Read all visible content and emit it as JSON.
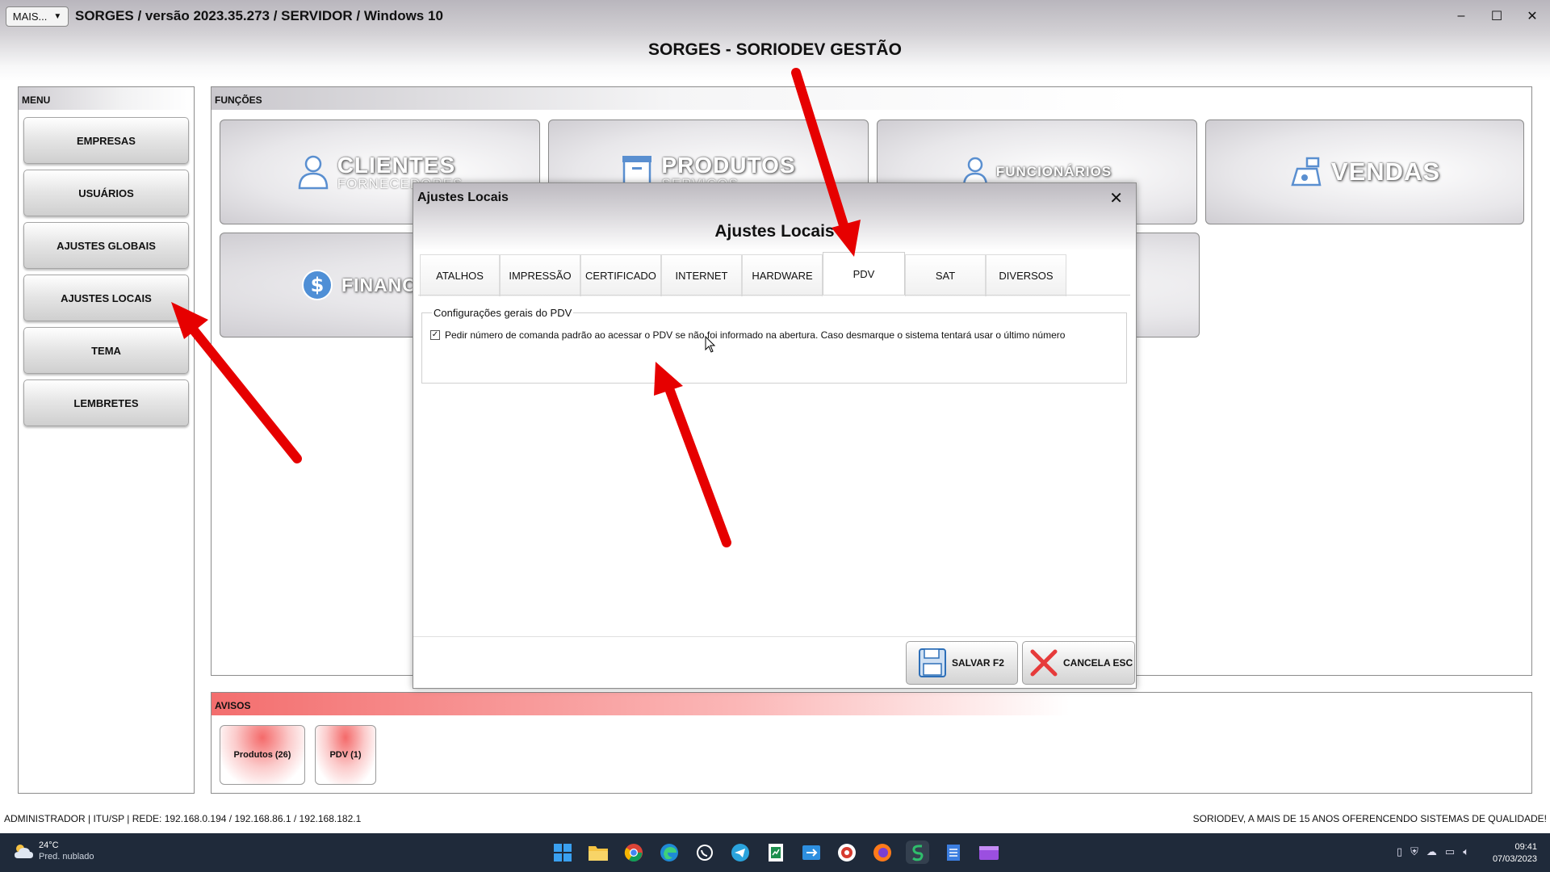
{
  "titlebar": {
    "mais_label": "MAIS...",
    "mais_arrow": "▼",
    "title": "SORGES / versão 2023.35.273 / SERVIDOR / Windows 10",
    "minimize": "–",
    "maximize": "☐",
    "close": "✕"
  },
  "header": {
    "title": "SORGES - SORIODEV GESTÃO"
  },
  "menu": {
    "heading": "MENU",
    "items": [
      {
        "label": "EMPRESAS"
      },
      {
        "label": "USUÁRIOS"
      },
      {
        "label": "AJUSTES GLOBAIS"
      },
      {
        "label": "AJUSTES LOCAIS"
      },
      {
        "label": "TEMA"
      },
      {
        "label": "LEMBRETES"
      }
    ]
  },
  "funcoes": {
    "heading": "FUNÇÕES",
    "tiles": [
      {
        "label": "CLIENTES",
        "sub": "FORNECEDORES",
        "icon": "person-icon"
      },
      {
        "label": "PRODUTOS",
        "sub": "SERVIÇOS",
        "icon": "box-icon"
      },
      {
        "label": "FUNCIONÁRIOS",
        "icon": "employee-icon"
      },
      {
        "label": "VENDAS",
        "icon": "cash-register-icon"
      },
      {
        "label": "FINANC",
        "icon": "dollar-icon"
      }
    ]
  },
  "avisos": {
    "heading": "AVISOS",
    "items": [
      {
        "label": "Produtos (26)"
      },
      {
        "label": "PDV (1)"
      }
    ]
  },
  "status": {
    "left": "ADMINISTRADOR |   ITU/SP |    REDE: 192.168.0.194 / 192.168.86.1 / 192.168.182.1",
    "right": "SORIODEV, A MAIS DE 15 ANOS OFERENCENDO SISTEMAS DE QUALIDADE!"
  },
  "dialog": {
    "title": "Ajustes Locais",
    "close": "✕",
    "header": "Ajustes Locais",
    "tabs": [
      {
        "label": "ATALHOS"
      },
      {
        "label": "IMPRESSÃO"
      },
      {
        "label": "CERTIFICADO"
      },
      {
        "label": "INTERNET"
      },
      {
        "label": "HARDWARE"
      },
      {
        "label": "PDV"
      },
      {
        "label": "SAT"
      },
      {
        "label": "DIVERSOS"
      }
    ],
    "active_tab": "PDV",
    "group_title": "Configurações gerais do PDV",
    "checkbox_label": "Pedir número de comanda padrão ao acessar o PDV se não foi informado na abertura. Caso desmarque o sistema tentará usar o último número",
    "checkbox_checked": true,
    "checkbox_mark": "✓",
    "save_label": "SALVAR F2",
    "cancel_label": "CANCELA ESC"
  },
  "taskbar": {
    "weather_temp": "24°C",
    "weather_desc": "Pred. nublado",
    "time": "09:41",
    "date": "07/03/2023",
    "apps": [
      {
        "icon": "windows-start-icon"
      },
      {
        "icon": "file-explorer-icon"
      },
      {
        "icon": "chrome-icon"
      },
      {
        "icon": "edge-icon"
      },
      {
        "icon": "whatsapp-icon"
      },
      {
        "icon": "telegram-icon"
      },
      {
        "icon": "spreadsheet-icon"
      },
      {
        "icon": "remote-app-icon"
      },
      {
        "icon": "app-icon"
      },
      {
        "icon": "firefox-icon"
      },
      {
        "icon": "sorges-icon"
      },
      {
        "icon": "notepad-icon"
      },
      {
        "icon": "video-editor-icon"
      }
    ]
  },
  "colors": {
    "arrow": "#e60000",
    "taskbar": "#1f2a3a",
    "avisos_head": "#f36e6e"
  }
}
